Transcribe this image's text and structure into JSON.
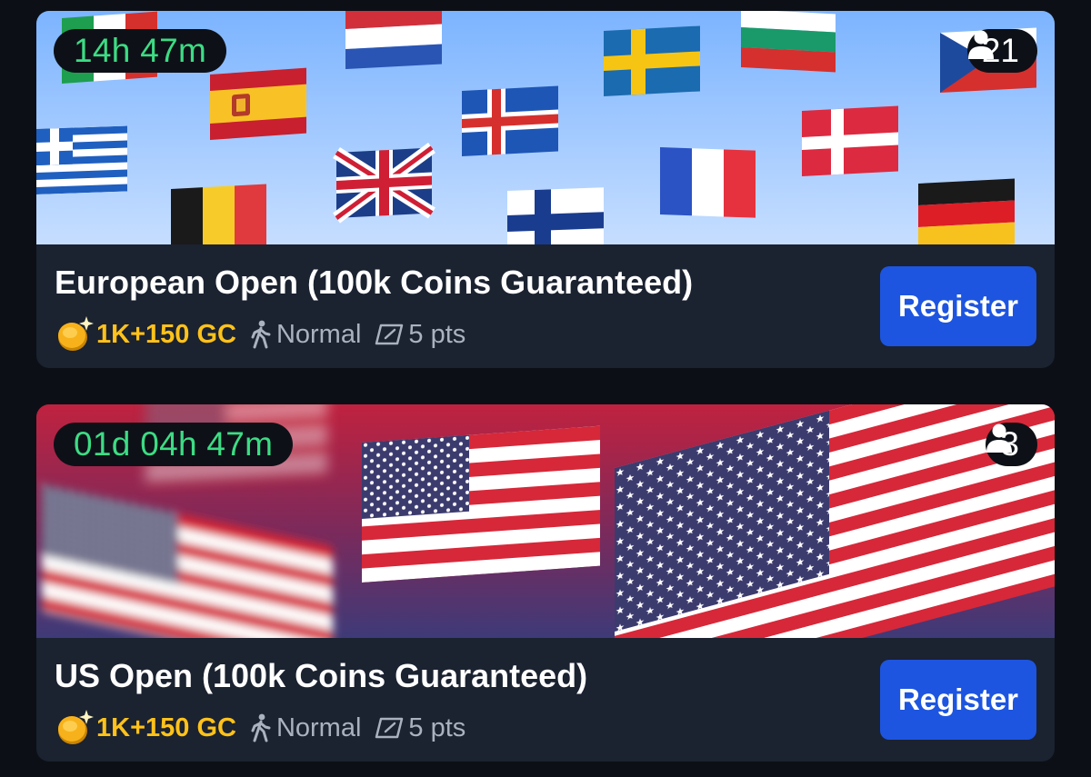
{
  "tournaments": [
    {
      "timer": "14h 47m",
      "players": "21",
      "title": "European Open (100k Coins Guaranteed)",
      "prize": "1K+150 GC",
      "speed": "Normal",
      "points": "5 pts",
      "button": "Register",
      "banner_theme": "european-flags"
    },
    {
      "timer": "01d 04h 47m",
      "players": "3",
      "title": "US Open (100k Coins Guaranteed)",
      "prize": "1K+150 GC",
      "speed": "Normal",
      "points": "5 pts",
      "button": "Register",
      "banner_theme": "us-flags"
    }
  ],
  "colors": {
    "timer_text": "#3ddc84",
    "prize_text": "#ffc21a",
    "register_button": "#1d55e0",
    "card_background": "#1b2230",
    "page_background": "#0c1016"
  },
  "icons": {
    "players": "person-icon",
    "prize": "gold-coin-icon",
    "speed": "walking-person-icon",
    "points": "tag-icon"
  }
}
